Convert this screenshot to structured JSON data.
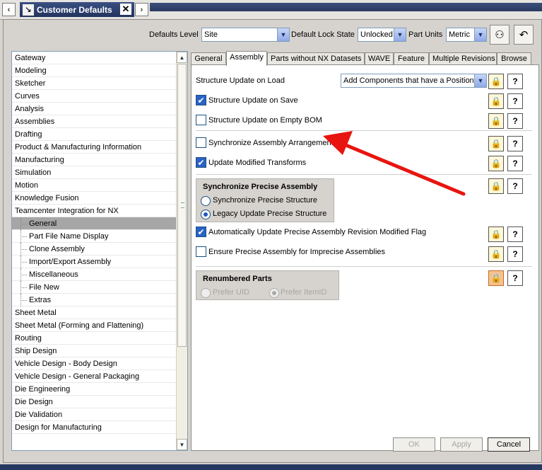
{
  "window": {
    "title": "Customer Defaults"
  },
  "header": {
    "defaults_level_label": "Defaults Level",
    "defaults_level_value": "Site",
    "lock_state_label": "Default Lock State",
    "lock_state_value": "Unlocked",
    "part_units_label": "Part Units",
    "part_units_value": "Metric"
  },
  "tree": {
    "items": [
      {
        "label": "Gateway"
      },
      {
        "label": "Modeling"
      },
      {
        "label": "Sketcher"
      },
      {
        "label": "Curves"
      },
      {
        "label": "Analysis"
      },
      {
        "label": "Assemblies"
      },
      {
        "label": "Drafting"
      },
      {
        "label": "Product & Manufacturing Information"
      },
      {
        "label": "Manufacturing"
      },
      {
        "label": "Simulation"
      },
      {
        "label": "Motion"
      },
      {
        "label": "Knowledge Fusion"
      },
      {
        "label": "Teamcenter Integration for NX"
      },
      {
        "label": "General"
      },
      {
        "label": "Part File Name Display"
      },
      {
        "label": "Clone Assembly"
      },
      {
        "label": "Import/Export Assembly"
      },
      {
        "label": "Miscellaneous"
      },
      {
        "label": "File New"
      },
      {
        "label": "Extras"
      },
      {
        "label": "Sheet Metal"
      },
      {
        "label": "Sheet Metal (Forming and Flattening)"
      },
      {
        "label": "Routing"
      },
      {
        "label": "Ship Design"
      },
      {
        "label": "Vehicle Design - Body Design"
      },
      {
        "label": "Vehicle Design - General Packaging"
      },
      {
        "label": "Die Engineering"
      },
      {
        "label": "Die Design"
      },
      {
        "label": "Die Validation"
      },
      {
        "label": "Design for Manufacturing"
      }
    ]
  },
  "tabs": [
    "General",
    "Assembly",
    "Parts without NX Datasets",
    "WAVE",
    "Feature",
    "Multiple Revisions",
    "Browse"
  ],
  "assembly": {
    "structure_update_on_load_label": "Structure Update on Load",
    "structure_update_on_load_value": "Add Components that have a Position",
    "structure_update_on_save": "Structure Update on Save",
    "structure_update_on_empty_bom": "Structure Update on Empty BOM",
    "sync_assembly_arrangements": "Synchronize Assembly Arrangements",
    "update_modified_transforms": "Update Modified Transforms",
    "sync_precise_group_title": "Synchronize Precise Assembly",
    "sync_precise_structure": "Synchronize Precise Structure",
    "legacy_update_precise_structure": "Legacy Update Precise Structure",
    "auto_update_precise_flag": "Automatically Update Precise Assembly Revision Modified Flag",
    "ensure_precise_for_imprecise": "Ensure Precise Assembly for Imprecise Assemblies",
    "renumbered_parts_title": "Renumbered Parts",
    "prefer_uid": "Prefer UID",
    "prefer_itemid": "Prefer ItemID",
    "help_glyph": "?"
  },
  "buttons": {
    "ok": "OK",
    "apply": "Apply",
    "cancel": "Cancel"
  },
  "icons": {
    "lock": "lock-icon",
    "help": "help-icon",
    "find": "binoculars-icon",
    "reset": "reset-arrow-icon"
  },
  "colors": {
    "annotation_arrow": "#e8140f",
    "title_bar": "#2c3d66"
  }
}
